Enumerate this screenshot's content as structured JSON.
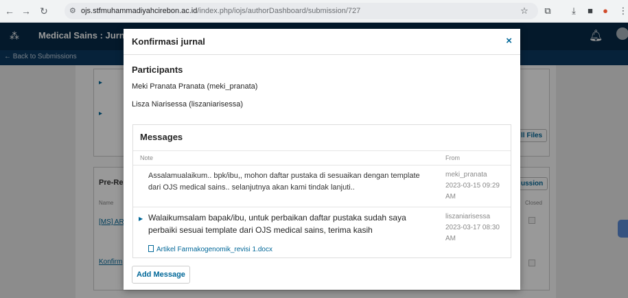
{
  "browser": {
    "url_host": "ojs.stfmuhammadiyahcirebon.ac.id",
    "url_path": "/index.php/iojs/authorDashboard/submission/727"
  },
  "app": {
    "title": "Medical Sains : Jurnal",
    "back_link": "← Back to Submissions"
  },
  "background": {
    "pre_review_title": "Pre-Re",
    "name_col": "Name",
    "closed_col": "Closed",
    "item1": "[MS] AR",
    "item2": "Konfirm",
    "all_files_btn": "ll Files",
    "discussion_btn": "ussion"
  },
  "modal": {
    "title": "Konfirmasi jurnal",
    "close_symbol": "×",
    "participants_title": "Participants",
    "participants": [
      "Meki Pranata Pranata (meki_pranata)",
      "Lisza Niarisessa (liszaniarisessa)"
    ],
    "messages_title": "Messages",
    "columns": {
      "note": "Note",
      "from": "From"
    },
    "messages": [
      {
        "note": "Assalamualaikum.. bpk/ibu,, mohon daftar pustaka di sesuaikan dengan template dari OJS medical sains.. selanjutnya akan kami tindak lanjuti..",
        "from_user": "meki_pranata",
        "from_date": "2023-03-15 09:29",
        "from_time": "AM"
      },
      {
        "note": "Walaikumsalam bapak/ibu, untuk perbaikan daftar pustaka sudah saya perbaiki sesuai template dari OJS medical sains, terima kasih",
        "from_user": "liszaniarisessa",
        "from_date": "2023-03-17 08:30",
        "from_time": "AM",
        "attachment": "Artikel Farmakogenomik_revisi 1.docx"
      }
    ],
    "add_message_label": "Add Message"
  }
}
